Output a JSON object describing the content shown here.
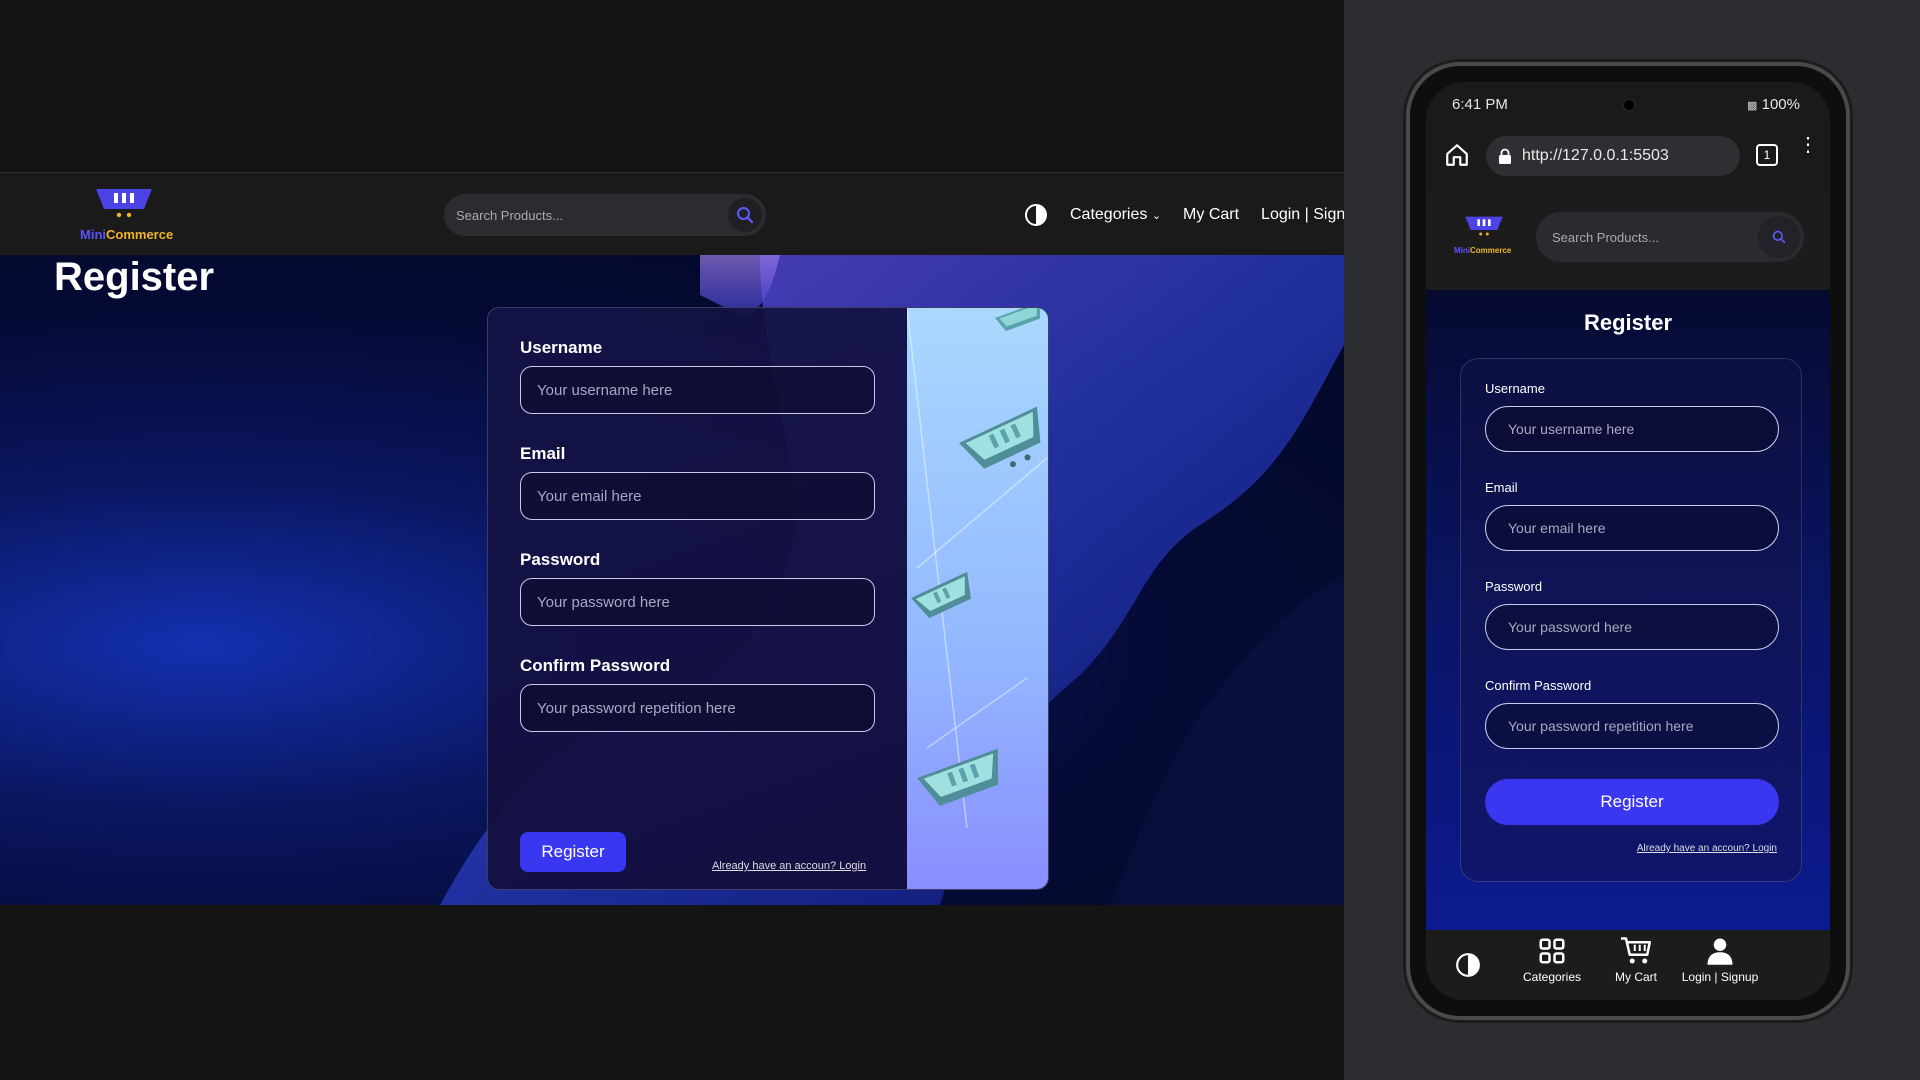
{
  "app": {
    "brand_part1": "Mini",
    "brand_part2": "Commerce"
  },
  "nav": {
    "search_placeholder": "Search Products...",
    "categories": "Categories",
    "cart": "My Cart",
    "login": "Login | Signup"
  },
  "page": {
    "title": "Register"
  },
  "form": {
    "username_label": "Username",
    "username_placeholder": "Your username here",
    "email_label": "Email",
    "email_placeholder": "Your email here",
    "password_label": "Password",
    "password_placeholder": "Your password here",
    "confirm_label": "Confirm Password",
    "confirm_placeholder": "Your password repetition here",
    "submit": "Register",
    "have_account": "Already have an accoun? Login"
  },
  "mobile": {
    "time": "6:41 PM",
    "battery": "100%",
    "url": "http://127.0.0.1:5503",
    "tab_count": "1",
    "bottom_nav": {
      "categories": "Categories",
      "cart": "My Cart",
      "login": "Login | Signup"
    }
  },
  "colors": {
    "accent": "#3a37f0",
    "brand_mini": "#5b52ff",
    "brand_commerce": "#f0b429"
  }
}
